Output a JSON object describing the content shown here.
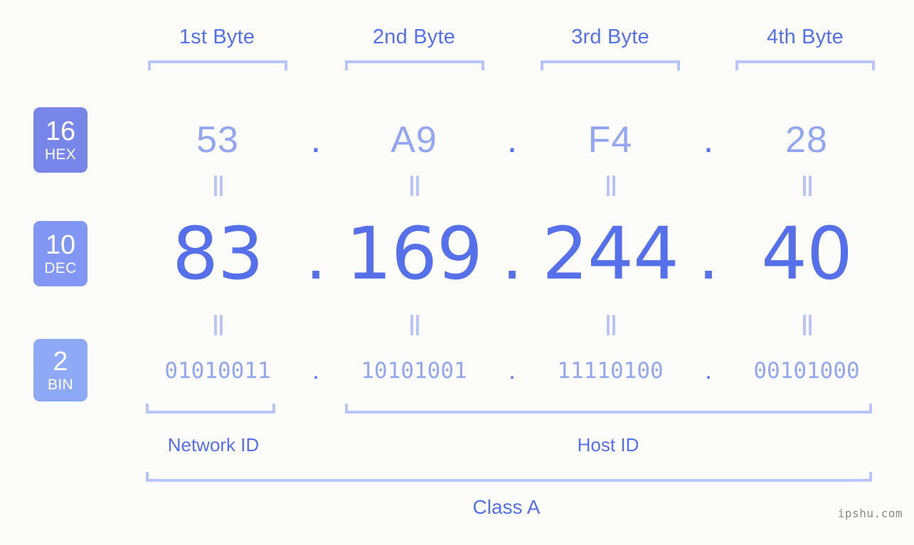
{
  "page": {
    "background_color": "#fcfdfa",
    "accent_color": "#5570e8",
    "muted_accent_color": "#93a6ef",
    "bracket_color": "#b9c4fb"
  },
  "byte_headers": [
    {
      "label": "1st Byte"
    },
    {
      "label": "2nd Byte"
    },
    {
      "label": "3rd Byte"
    },
    {
      "label": "4th Byte"
    }
  ],
  "bases": [
    {
      "number": "16",
      "name": "HEX",
      "color": "#7786e8"
    },
    {
      "number": "10",
      "name": "DEC",
      "color": "#8296f3"
    },
    {
      "number": "2",
      "name": "BIN",
      "color": "#8eaaf7"
    }
  ],
  "rows": {
    "hex": {
      "values": [
        "53",
        "A9",
        "F4",
        "28"
      ],
      "separator": "."
    },
    "dec": {
      "values": [
        "83",
        "169",
        "244",
        "40"
      ],
      "separator": "."
    },
    "bin": {
      "values": [
        "01010011",
        "10101001",
        "11110100",
        "00101000"
      ],
      "separator": "."
    }
  },
  "equality": {
    "symbol": "="
  },
  "sections": [
    {
      "label": "Network ID"
    },
    {
      "label": "Host ID"
    }
  ],
  "class": {
    "label": "Class A"
  },
  "watermark": {
    "text": "ipshu.com"
  }
}
